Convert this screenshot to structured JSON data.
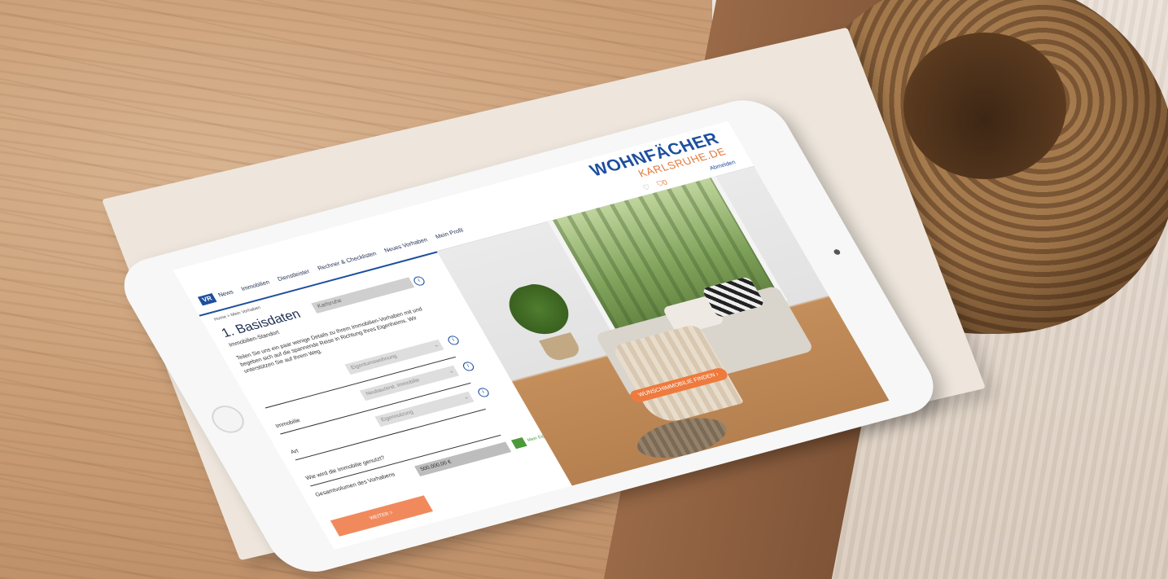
{
  "brand": {
    "name_line1": "WOHNFÄCHER",
    "name_line2": "KARLSRUHE.DE"
  },
  "header": {
    "logout": "Abmelden",
    "cart_count": "0"
  },
  "nav": {
    "items": [
      "News",
      "Immobilien",
      "Dienstleister",
      "Rechner & Checklisten",
      "Neues Vorhaben",
      "Mein Profil"
    ]
  },
  "breadcrumb": "Home > Mein Vorhaben",
  "form": {
    "title": "1. Basisdaten",
    "location_label": "Immobilien-Standort",
    "location_value": "Karlsruhe",
    "intro": "Teilen Sie uns ein paar wenige Details zu Ihrem Immobilien-Vorhaben mit und begeben sich auf die spannende Reise in Richtung Ihres Eigenheims. Wir unterstützen Sie auf Ihrem Weg.",
    "fields": [
      {
        "label": "",
        "value": "Eigentumswohnung"
      },
      {
        "label": "Immobilie",
        "value": "Neubau/erst. Immobilie"
      },
      {
        "label": "Art",
        "value": "Eigennutzung"
      },
      {
        "label": "Wie wird die Immobilie genutzt?",
        "value": ""
      }
    ],
    "volume_label": "Gesamtvolumen des Vorhabens",
    "volume_value": "500.000,00 €",
    "equity_note": "Mein Eigenanteil aus eigenen Mitteln",
    "next_button": "WEITER >"
  },
  "hero": {
    "cta": "WUNSCHIMMOBILIE FINDEN ›"
  },
  "icons": {
    "heart": "heart-icon",
    "cart": "cart-icon",
    "info": "info-icon",
    "chevron": "chevron-down-icon"
  },
  "colors": {
    "primary_blue": "#1d4f9e",
    "accent_orange": "#ee7a3d",
    "button_orange": "#f08a5d",
    "green": "#4c9a3a"
  }
}
